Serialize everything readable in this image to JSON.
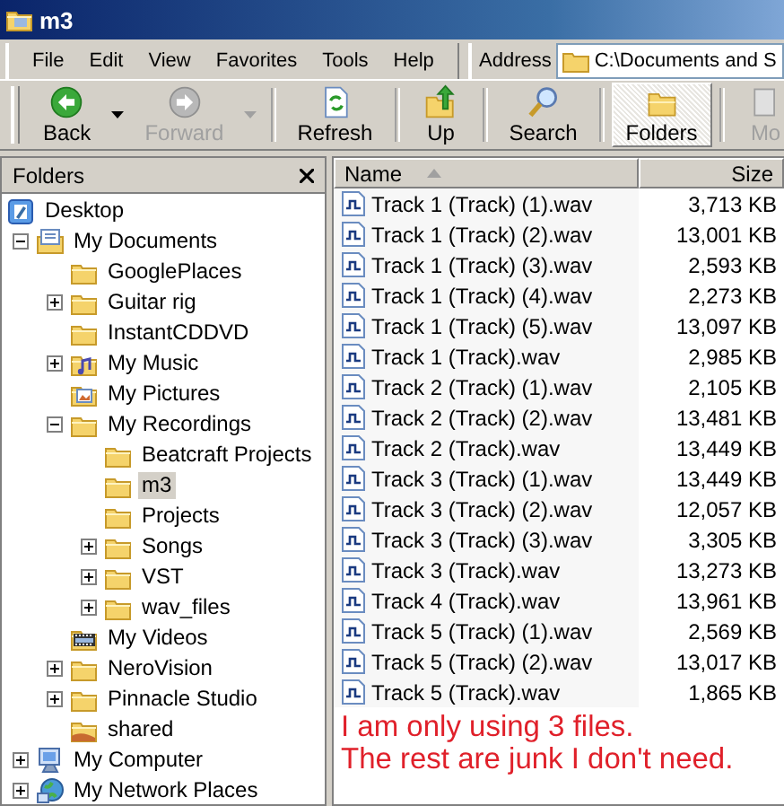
{
  "window": {
    "title": "m3"
  },
  "menu": [
    "File",
    "Edit",
    "View",
    "Favorites",
    "Tools",
    "Help"
  ],
  "address": {
    "label": "Address",
    "value": "C:\\Documents and S"
  },
  "toolbar": [
    {
      "label": "Back",
      "kind": "back",
      "disabled": false,
      "dropdown": true,
      "selected": false
    },
    {
      "label": "Forward",
      "kind": "forward",
      "disabled": true,
      "dropdown": true,
      "selected": false
    },
    {
      "label": "Refresh",
      "kind": "refresh",
      "disabled": false,
      "dropdown": false,
      "selected": false
    },
    {
      "label": "Up",
      "kind": "up",
      "disabled": false,
      "dropdown": false,
      "selected": false
    },
    {
      "label": "Search",
      "kind": "search",
      "disabled": false,
      "dropdown": false,
      "selected": false
    },
    {
      "label": "Folders",
      "kind": "folders",
      "disabled": false,
      "dropdown": false,
      "selected": true
    },
    {
      "label": "Mo",
      "kind": "move",
      "disabled": true,
      "dropdown": false,
      "selected": false
    }
  ],
  "folders_pane": {
    "title": "Folders"
  },
  "tree": [
    {
      "label": "Desktop",
      "kind": "desktop",
      "selected": false,
      "children": [
        {
          "label": "My Documents",
          "kind": "documents",
          "expandable": true,
          "expanded": true,
          "selected": false,
          "children": [
            {
              "label": "GooglePlaces",
              "kind": "folder",
              "expandable": false,
              "expanded": false,
              "selected": false
            },
            {
              "label": "Guitar rig",
              "kind": "folder",
              "expandable": true,
              "expanded": false,
              "selected": false
            },
            {
              "label": "InstantCDDVD",
              "kind": "folder",
              "expandable": false,
              "expanded": false,
              "selected": false
            },
            {
              "label": "My Music",
              "kind": "music",
              "expandable": true,
              "expanded": false,
              "selected": false
            },
            {
              "label": "My Pictures",
              "kind": "pictures",
              "expandable": false,
              "expanded": false,
              "selected": false
            },
            {
              "label": "My Recordings",
              "kind": "folder",
              "expandable": true,
              "expanded": true,
              "selected": false,
              "children": [
                {
                  "label": "Beatcraft Projects",
                  "kind": "folder",
                  "expandable": false,
                  "expanded": false,
                  "selected": false
                },
                {
                  "label": "m3",
                  "kind": "folder",
                  "expandable": false,
                  "expanded": false,
                  "selected": true
                },
                {
                  "label": "Projects",
                  "kind": "folder",
                  "expandable": false,
                  "expanded": false,
                  "selected": false
                },
                {
                  "label": "Songs",
                  "kind": "folder",
                  "expandable": true,
                  "expanded": false,
                  "selected": false
                },
                {
                  "label": "VST",
                  "kind": "folder",
                  "expandable": true,
                  "expanded": false,
                  "selected": false
                },
                {
                  "label": "wav_files",
                  "kind": "folder",
                  "expandable": true,
                  "expanded": false,
                  "selected": false
                }
              ]
            },
            {
              "label": "My Videos",
              "kind": "videos",
              "expandable": false,
              "expanded": false,
              "selected": false
            },
            {
              "label": "NeroVision",
              "kind": "folder",
              "expandable": true,
              "expanded": false,
              "selected": false
            },
            {
              "label": "Pinnacle Studio",
              "kind": "folder",
              "expandable": true,
              "expanded": false,
              "selected": false
            },
            {
              "label": "shared",
              "kind": "shared",
              "expandable": false,
              "expanded": false,
              "selected": false
            }
          ]
        },
        {
          "label": "My Computer",
          "kind": "computer",
          "expandable": true,
          "expanded": false,
          "selected": false
        },
        {
          "label": "My Network Places",
          "kind": "network",
          "expandable": true,
          "expanded": false,
          "selected": false
        }
      ]
    }
  ],
  "columns": [
    {
      "label": "Name",
      "sorted": true
    },
    {
      "label": "Size",
      "sorted": false
    }
  ],
  "files": [
    {
      "name": "Track 1 (Track) (1).wav",
      "size": "3,713 KB"
    },
    {
      "name": "Track 1 (Track) (2).wav",
      "size": "13,001 KB"
    },
    {
      "name": "Track 1 (Track) (3).wav",
      "size": "2,593 KB"
    },
    {
      "name": "Track 1 (Track) (4).wav",
      "size": "2,273 KB"
    },
    {
      "name": "Track 1 (Track) (5).wav",
      "size": "13,097 KB"
    },
    {
      "name": "Track 1 (Track).wav",
      "size": "2,985 KB"
    },
    {
      "name": "Track 2 (Track) (1).wav",
      "size": "2,105 KB"
    },
    {
      "name": "Track 2 (Track) (2).wav",
      "size": "13,481 KB"
    },
    {
      "name": "Track 2 (Track).wav",
      "size": "13,449 KB"
    },
    {
      "name": "Track 3 (Track) (1).wav",
      "size": "13,449 KB"
    },
    {
      "name": "Track 3 (Track) (2).wav",
      "size": "12,057 KB"
    },
    {
      "name": "Track 3 (Track) (3).wav",
      "size": "3,305 KB"
    },
    {
      "name": "Track 3 (Track).wav",
      "size": "13,273 KB"
    },
    {
      "name": "Track 4 (Track).wav",
      "size": "13,961 KB"
    },
    {
      "name": "Track 5 (Track) (1).wav",
      "size": "2,569 KB"
    },
    {
      "name": "Track 5 (Track) (2).wav",
      "size": "13,017 KB"
    },
    {
      "name": "Track 5 (Track).wav",
      "size": "1,865 KB"
    }
  ],
  "note": [
    "I am only using 3 files.",
    "The rest are junk I don't need."
  ]
}
